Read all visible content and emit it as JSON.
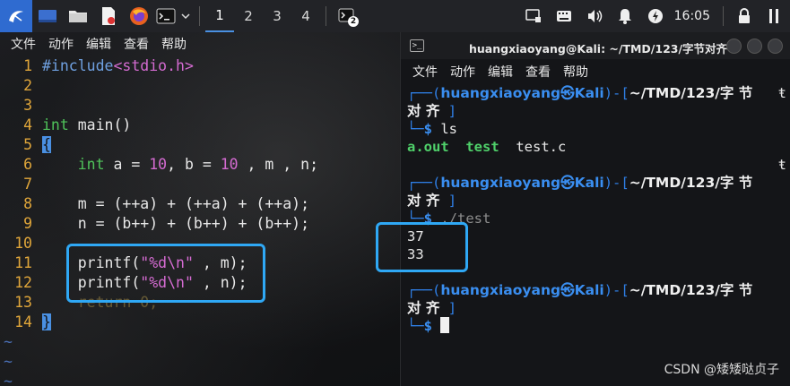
{
  "taskbar": {
    "workspaces": [
      "1",
      "2",
      "3",
      "4"
    ],
    "active_workspace": "1",
    "terminal_badge": "2",
    "clock": "16:05",
    "accent": "#2f6bd0"
  },
  "editor": {
    "menu": [
      "文件",
      "动作",
      "编辑",
      "查看",
      "帮助"
    ],
    "lines": [
      {
        "n": "1"
      },
      {
        "n": "2"
      },
      {
        "n": "3"
      },
      {
        "n": "4"
      },
      {
        "n": "5"
      },
      {
        "n": "6"
      },
      {
        "n": "7"
      },
      {
        "n": "8"
      },
      {
        "n": "9"
      },
      {
        "n": "10"
      },
      {
        "n": "11"
      },
      {
        "n": "12"
      },
      {
        "n": "13"
      },
      {
        "n": "14"
      }
    ],
    "code": {
      "l1_pre": "#include",
      "l1_hdr": "<stdio.h>",
      "l4_type": "int",
      "l4_rest": " main()",
      "l5": "{",
      "l6_type": "int",
      "l6_a": " a = ",
      "l6_n1": "10",
      "l6_b": ", b = ",
      "l6_n2": "10",
      "l6_rest": " , m , n;",
      "l8": "m = (++a) + (++a) + (++a);",
      "l9": "n = (b++) + (b++) + (b++);",
      "l11_a": "printf(",
      "l11_s": "\"%d\\n\"",
      "l11_b": " , m);",
      "l12_a": "printf(",
      "l12_s": "\"%d\\n\"",
      "l12_b": " , n);",
      "l13": "return 0;",
      "l14": "}"
    },
    "tilde": "~"
  },
  "terminal": {
    "title": "huangxiaoyang@Kali: ~/TMD/123/字节对齐",
    "menu": [
      "文件",
      "动作",
      "编辑",
      "查看",
      "帮助"
    ],
    "prompt_user": "huangxiaoyang㉿Kali",
    "prompt_path": "~/TMD/123/字 节",
    "prompt_path_wrap": "对 齐",
    "cmd1": "ls",
    "ls_exe1": "a.out",
    "ls_exe2": "test",
    "ls_file": "test.c",
    "cmd2": "./test",
    "out1": "37",
    "out2": "33",
    "wrap_mark": "ŧ"
  },
  "watermark": "CSDN @矮矮哒贞子",
  "colors": {
    "highlight_box": "#2fa8f5",
    "prompt_blue": "#2f7fe6",
    "exe_green": "#4fd06a"
  }
}
